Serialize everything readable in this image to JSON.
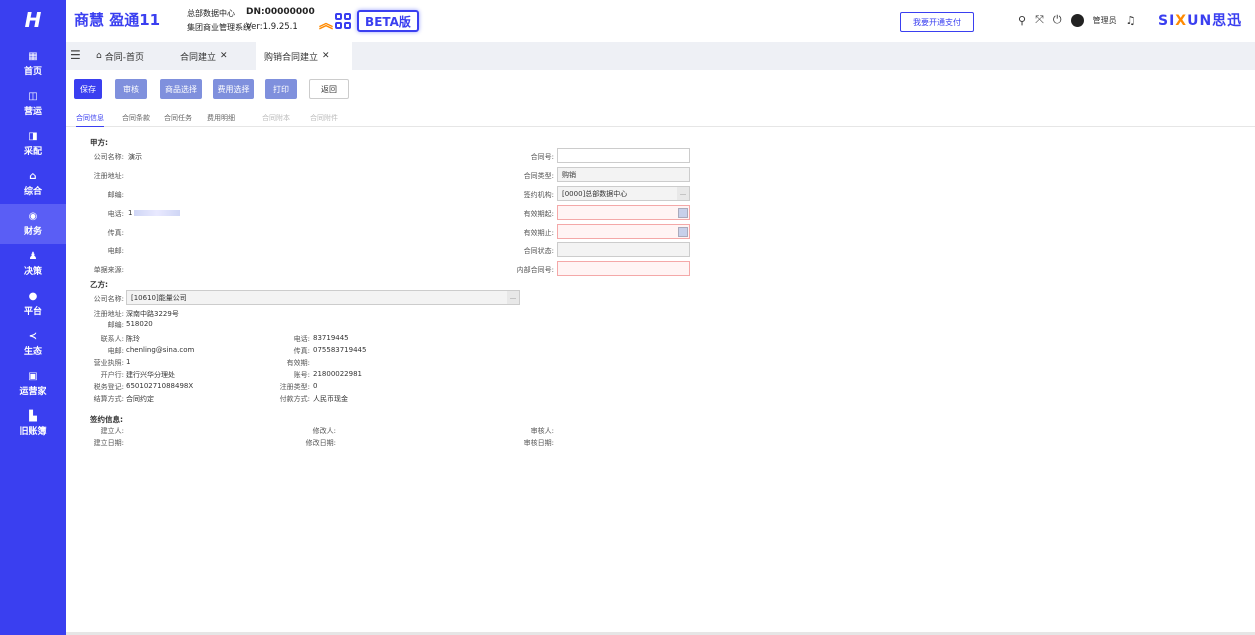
{
  "sidebar": {
    "logo": "H",
    "items": [
      {
        "label": "首页",
        "icon": "grid-icon"
      },
      {
        "label": "营运",
        "icon": "chart-icon"
      },
      {
        "label": "采配",
        "icon": "truck-icon"
      },
      {
        "label": "综合",
        "icon": "bag-icon"
      },
      {
        "label": "财务",
        "icon": "coin-icon"
      },
      {
        "label": "决策",
        "icon": "person-icon"
      },
      {
        "label": "平台",
        "icon": "dot-icon"
      },
      {
        "label": "生态",
        "icon": "share-icon"
      },
      {
        "label": "运营家",
        "icon": "board-icon"
      },
      {
        "label": "旧账簿",
        "icon": "book-icon"
      }
    ]
  },
  "header": {
    "brand": "商慧 盈通11",
    "sys_line1": "总部数据中心",
    "sys_line2": "集团商业管理系统",
    "dn": "DN:00000000",
    "version": "Ver:1.9.25.1",
    "beta": "BETA版",
    "pay_button": "我要开通支付",
    "admin": "管理员",
    "company_logo_a": "SI",
    "company_logo_b": "X",
    "company_logo_c": "UN思迅"
  },
  "tabs": [
    {
      "label": "合同-首页",
      "closable": false
    },
    {
      "label": "合同建立",
      "closable": true
    },
    {
      "label": "购销合同建立",
      "closable": true,
      "active": true
    }
  ],
  "toolbar": {
    "save": "保存",
    "review": "审核",
    "goods": "商品选择",
    "fee": "费用选择",
    "print": "打印",
    "back": "返回"
  },
  "subtabs": [
    "合同信息",
    "合同条款",
    "合同任务",
    "费用明细",
    "合同附本",
    "合同附件"
  ],
  "party_a": {
    "title": "甲方:",
    "company_label": "公司名称:",
    "company": "演示",
    "address_label": "注册地址:",
    "postcode_label": "邮编:",
    "phone_label": "电话:",
    "phone": "1",
    "fax_label": "传真:",
    "email_label": "电邮:",
    "source_label": "单据来源:"
  },
  "contract": {
    "no_label": "合同号:",
    "type_label": "合同类型:",
    "type": "购销",
    "org_label": "签约机构:",
    "org": "[0000]总部数据中心",
    "start_label": "有效期起:",
    "end_label": "有效期止:",
    "status_label": "合同状态:",
    "inner_label": "内部合同号:"
  },
  "party_b": {
    "title": "乙方:",
    "company_label": "公司名称:",
    "company": "[10610]能量公司",
    "address_label": "注册地址:",
    "address": "深南中路3229号",
    "postcode_label": "邮编:",
    "postcode": "518020",
    "contact_label": "联系人:",
    "contact": "陈玲",
    "phone_label": "电话:",
    "phone": "83719445",
    "email_label": "电邮:",
    "email": "chenling@sina.com",
    "fax_label": "传真:",
    "fax": "075583719445",
    "license_label": "营业执照:",
    "license": "1",
    "valid_label": "有效期:",
    "bank_label": "开户行:",
    "bank": "建行兴华分理处",
    "account_label": "账号:",
    "account": "21800022981",
    "tax_label": "税务登记:",
    "tax": "650102710884​98X",
    "regtype_label": "注册类型:",
    "regtype": "0",
    "settle_label": "结算方式:",
    "settle": "合同约定",
    "paymode_label": "付款方式:",
    "paymode": "人民币现金"
  },
  "sign": {
    "title": "签约信息:",
    "creator_label": "建立人:",
    "modifier_label": "修改人:",
    "reviewer_label": "审核人:",
    "create_date_label": "建立日期:",
    "modify_date_label": "修改日期:",
    "review_date_label": "审核日期:"
  },
  "colors": {
    "brand": "#3a3ff0",
    "accent": "#ff8a00"
  }
}
